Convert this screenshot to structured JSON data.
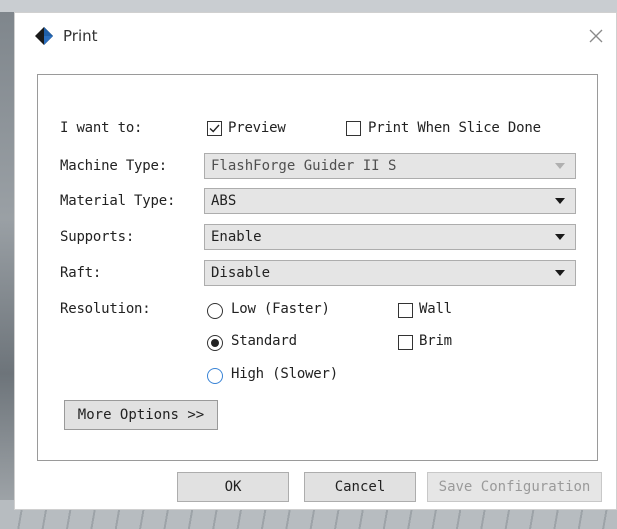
{
  "window": {
    "title": "Print",
    "icon": "diamond-app-icon",
    "close": "close-icon"
  },
  "form": {
    "i_want_to_label": "I want to:",
    "preview": {
      "label": "Preview",
      "checked": true
    },
    "print_when_done": {
      "label": "Print When Slice Done",
      "checked": false
    },
    "machine_type": {
      "label": "Machine Type:",
      "value": "FlashForge Guider II S"
    },
    "material_type": {
      "label": "Material Type:",
      "value": "ABS"
    },
    "supports": {
      "label": "Supports:",
      "value": "Enable"
    },
    "raft": {
      "label": "Raft:",
      "value": "Disable"
    },
    "resolution": {
      "label": "Resolution:",
      "low": "Low (Faster)",
      "standard": "Standard",
      "high": "High (Slower)",
      "selected": "Standard"
    },
    "wall": {
      "label": "Wall",
      "checked": false
    },
    "brim": {
      "label": "Brim",
      "checked": false
    },
    "more_options": "More Options >>"
  },
  "buttons": {
    "ok": "OK",
    "cancel": "Cancel",
    "save": "Save Configuration"
  },
  "colors": {
    "accent": "#3a84d6",
    "icon_blue": "#1f5fa8",
    "icon_dark": "#1a1a1a"
  }
}
